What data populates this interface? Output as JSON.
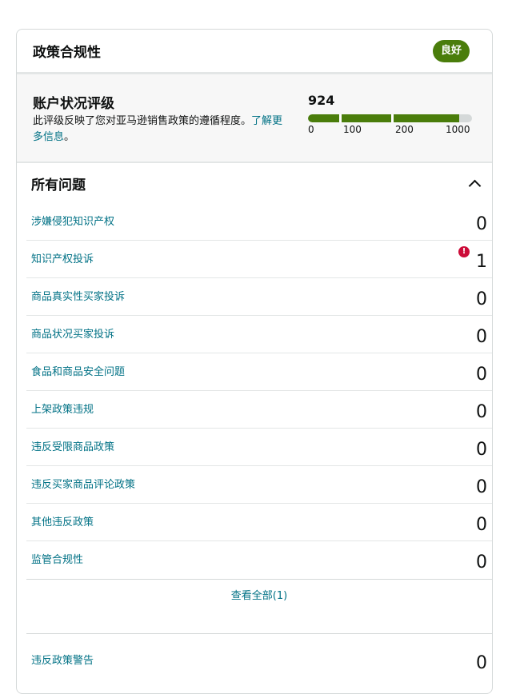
{
  "header": {
    "title": "政策合规性",
    "status_badge": "良好"
  },
  "rating": {
    "title": "账户状况评级",
    "description": "此评级反映了您对亚马逊销售政策的遵循程度。",
    "learn_more": "了解更多信息",
    "suffix": "。",
    "score": "924",
    "score_value": 924,
    "scale_max": 1000,
    "ticks": [
      "0",
      "100",
      "200",
      "1000"
    ]
  },
  "issues": {
    "title": "所有问题",
    "items": [
      {
        "label": "涉嫌侵犯知识产权",
        "count": "0"
      },
      {
        "label": "知识产权投诉",
        "count": "1"
      },
      {
        "label": "商品真实性买家投诉",
        "count": "0"
      },
      {
        "label": "商品状况买家投诉",
        "count": "0"
      },
      {
        "label": "食品和商品安全问题",
        "count": "0"
      },
      {
        "label": "上架政策违规",
        "count": "0"
      },
      {
        "label": "违反受限商品政策",
        "count": "0"
      },
      {
        "label": "违反买家商品评论政策",
        "count": "0"
      },
      {
        "label": "其他违反政策",
        "count": "0"
      },
      {
        "label": "监管合规性",
        "count": "0"
      }
    ],
    "view_all": "查看全部(1)"
  },
  "warnings": {
    "label": "违反政策警告",
    "count": "0"
  },
  "colors": {
    "good": "#4a7d0b",
    "link": "#007185",
    "alert": "#cc0c39"
  }
}
